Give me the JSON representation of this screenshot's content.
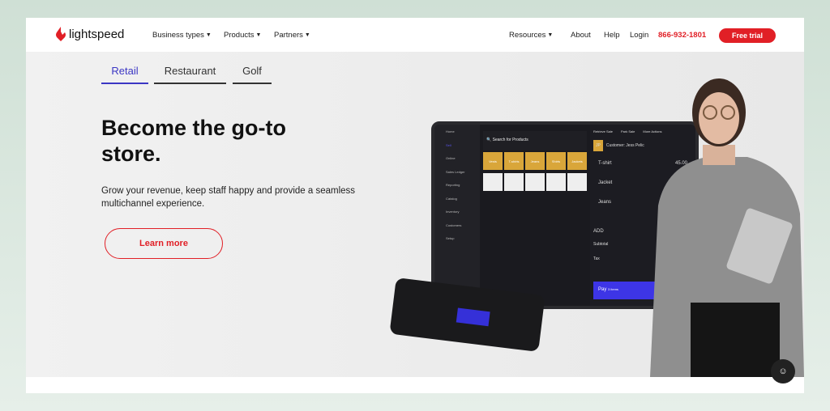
{
  "nav": {
    "logo": "lightspeed",
    "business_types": "Business types",
    "products": "Products",
    "partners": "Partners",
    "resources": "Resources",
    "about": "About",
    "help": "Help",
    "login": "Login",
    "phone": "866-932-1801",
    "free_trial": "Free trial"
  },
  "tabs": [
    {
      "label": "Retail",
      "active": true
    },
    {
      "label": "Restaurant"
    },
    {
      "label": "Golf"
    }
  ],
  "hero": {
    "title": "Become the go-to store.",
    "subtitle": "Grow your revenue, keep staff happy and provide a seamless multichannel experience.",
    "cta": "Learn more"
  },
  "pos": {
    "sidebar": [
      "Home",
      "Sell",
      "Online",
      "Sales Ledger",
      "Reporting",
      "Catalog",
      "Inventory",
      "Customers",
      "Setup"
    ],
    "search": "Search for Products",
    "categories": [
      "Vests",
      "T-shirts",
      "Jeans",
      "Shirts",
      "Jackets"
    ],
    "actions": [
      "Retrieve Sale",
      "Park Sale",
      "More Actions"
    ],
    "customer": "Customer: Jess Pelic",
    "customer_initials": "JP",
    "items": [
      "T-shirt",
      "Jacket",
      "Jeans"
    ],
    "price": "45.00",
    "add": "ADD",
    "subtotal": "Subtotal",
    "tax": "Tax",
    "pay": "Pay",
    "pay_items": "3 items"
  },
  "colors": {
    "brand": "#e11f26",
    "accent": "#3b36c4"
  }
}
